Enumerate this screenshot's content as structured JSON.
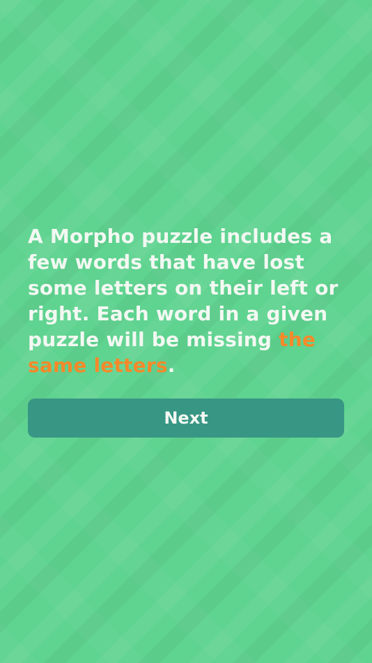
{
  "intro": {
    "text_before": "A Morpho puzzle includes a few words that have lost some letters on their left or right. Each word in a given puzzle will be missing ",
    "highlight": "the same letters",
    "text_after": "."
  },
  "next_button": {
    "label": "Next"
  },
  "colors": {
    "background": "#5fd390",
    "text": "#f3f8f2",
    "highlight": "#f5892a",
    "button": "#389685"
  }
}
